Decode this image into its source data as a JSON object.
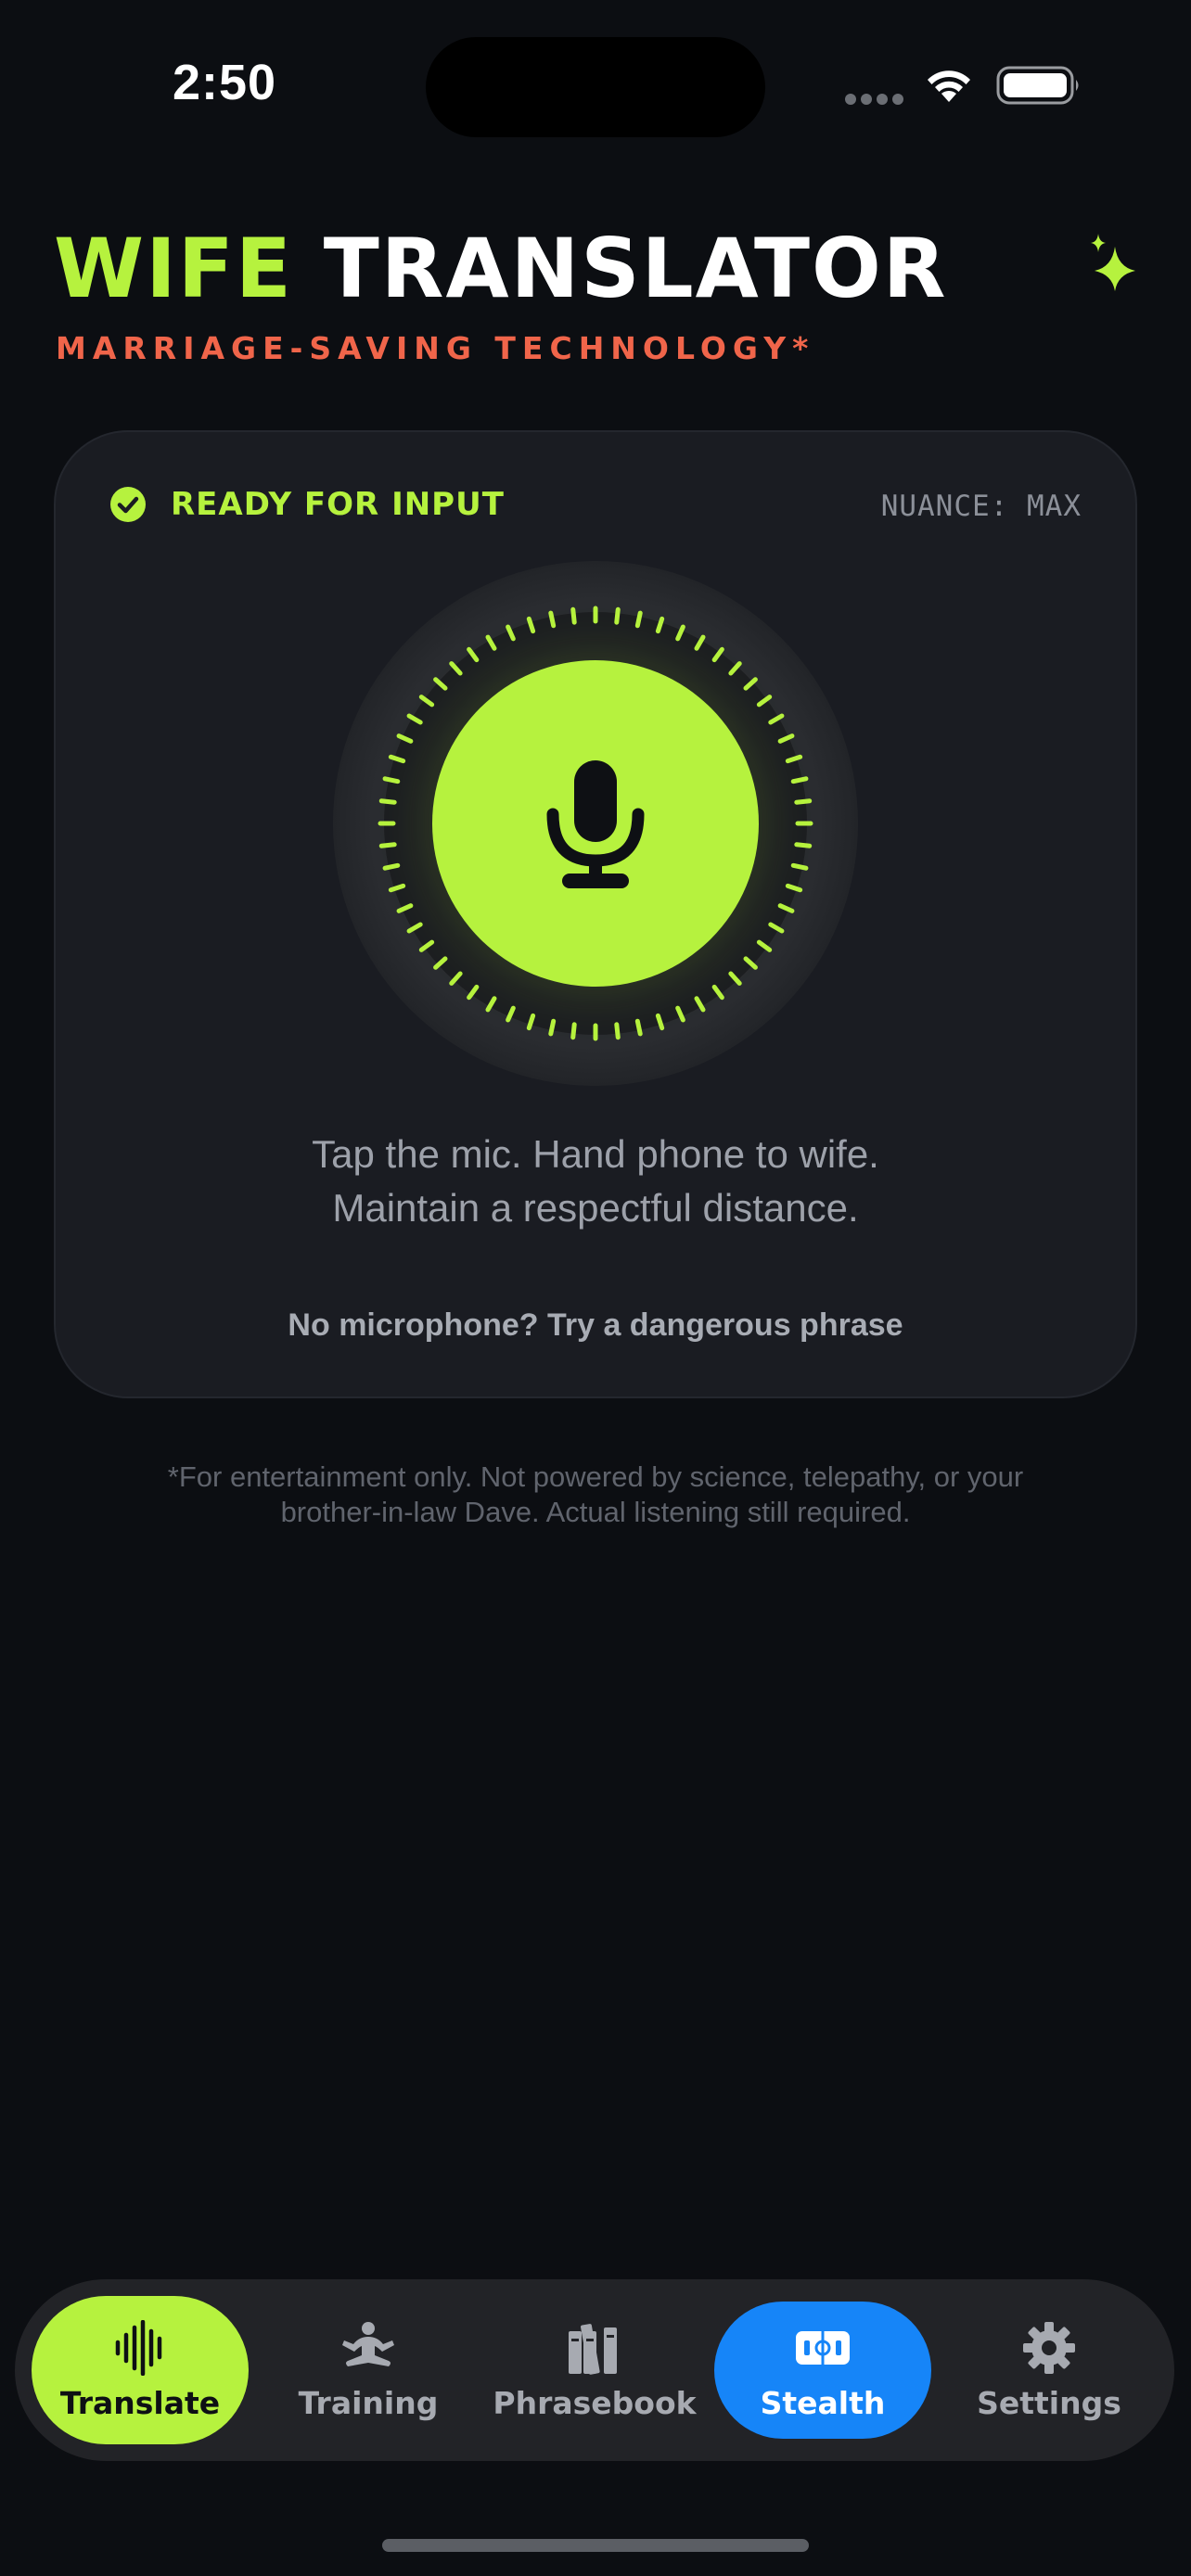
{
  "status_bar": {
    "time": "2:50"
  },
  "header": {
    "title_accent": "WIFE",
    "title_rest": "TRANSLATOR",
    "subtitle": "MARRIAGE-SAVING TECHNOLOGY*",
    "sparkle_icon": "sparkle-icon"
  },
  "card": {
    "status_label": "READY FOR INPUT",
    "nuance_label": "NUANCE: MAX",
    "instructions_line1": "Tap the mic. Hand phone to wife.",
    "instructions_line2": "Maintain a respectful distance.",
    "alt_action": "No microphone? Try a dangerous phrase"
  },
  "disclaimer": {
    "line1": "*For entertainment only. Not powered by science, telepathy, or your",
    "line2": "brother-in-law Dave. Actual listening still required."
  },
  "tabs": [
    {
      "label": "Translate",
      "icon": "waveform-icon",
      "active": true
    },
    {
      "label": "Training",
      "icon": "meditation-icon"
    },
    {
      "label": "Phrasebook",
      "icon": "books-icon"
    },
    {
      "label": "Stealth",
      "icon": "stealth-icon",
      "highlight": true
    },
    {
      "label": "Settings",
      "icon": "gear-icon"
    }
  ],
  "colors": {
    "accent": "#b6f23e",
    "subtitle": "#f0654a",
    "stealth": "#1685f8",
    "background": "#0c0e12",
    "card": "#1a1c22"
  }
}
